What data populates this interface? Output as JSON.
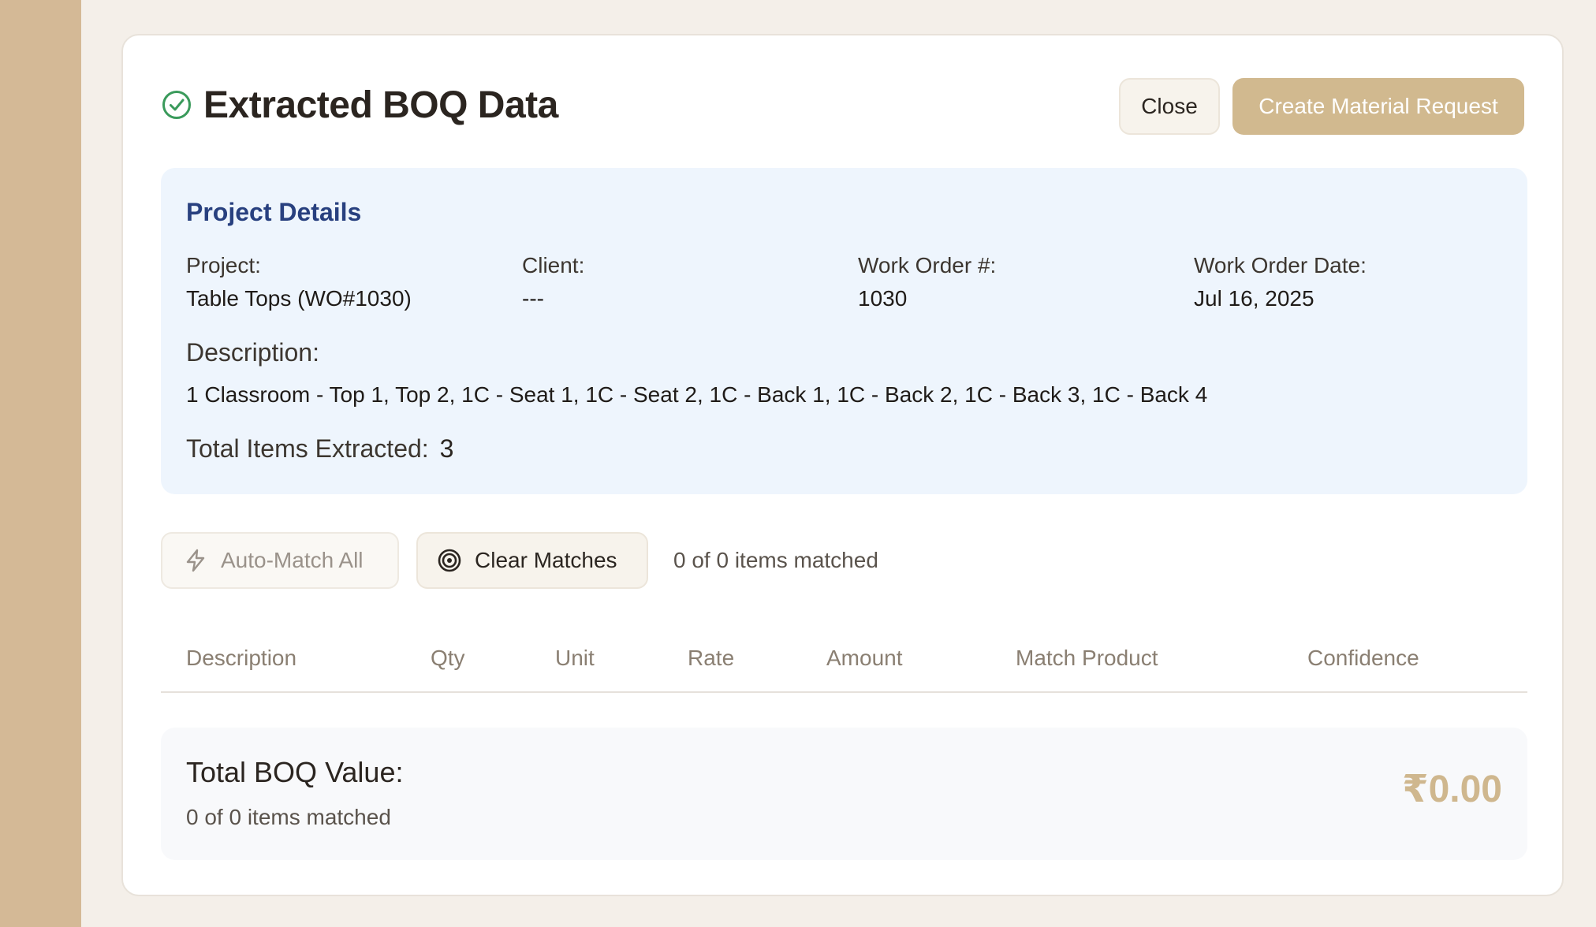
{
  "dialog": {
    "title": "Extracted BOQ Data",
    "close_label": "Close",
    "create_label": "Create Material Request"
  },
  "project": {
    "heading": "Project Details",
    "fields": [
      {
        "label": "Project:",
        "value": "Table Tops (WO#1030)"
      },
      {
        "label": "Client:",
        "value": "---"
      },
      {
        "label": "Work Order #:",
        "value": "1030"
      },
      {
        "label": "Work Order Date:",
        "value": "Jul 16, 2025"
      }
    ],
    "description_label": "Description:",
    "description": "1 Classroom - Top 1, Top 2, 1C - Seat 1, 1C - Seat 2, 1C - Back 1, 1C - Back 2, 1C - Back 3, 1C - Back 4",
    "total_items_label": "Total Items Extracted:",
    "total_items": "3"
  },
  "actions": {
    "auto_match_label": "Auto-Match All",
    "clear_matches_label": "Clear Matches",
    "match_status": "0 of 0 items matched"
  },
  "table": {
    "columns": [
      "Description",
      "Qty",
      "Unit",
      "Rate",
      "Amount",
      "Match Product",
      "Confidence"
    ]
  },
  "summary": {
    "title": "Total BOQ Value:",
    "subtitle": "0 of 0 items matched",
    "value": "₹0.00"
  },
  "colors": {
    "accent": "#d1b98f",
    "sidebar": "#d4b996",
    "project_panel": "#eef5fd",
    "project_heading": "#28407f",
    "success": "#3a9a5b"
  },
  "icons": {
    "title": "check-circle-icon",
    "auto_match": "lightning-icon",
    "clear_matches": "target-icon"
  }
}
